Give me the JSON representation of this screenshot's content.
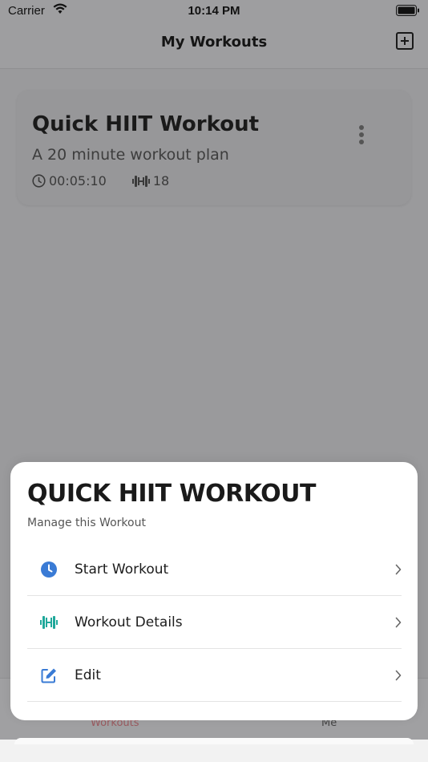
{
  "status_bar": {
    "carrier": "Carrier",
    "time": "10:14 PM"
  },
  "nav": {
    "title": "My Workouts",
    "add_icon": "plus-square-icon"
  },
  "workout_card": {
    "title": "Quick HIIT Workout",
    "subtitle": "A 20 minute workout plan",
    "duration": "00:05:10",
    "exercise_count": "18",
    "more_icon": "vertical-ellipsis-icon"
  },
  "tabs": [
    {
      "label": "Workouts",
      "active": true
    },
    {
      "label": "Me",
      "active": false
    }
  ],
  "sheet": {
    "title": "QUICK HIIT WORKOUT",
    "subtitle": "Manage this Workout",
    "actions": [
      {
        "label": "Start Workout",
        "icon": "clock-icon",
        "color": "#3a7bd5"
      },
      {
        "label": "Workout Details",
        "icon": "dumbbell-icon",
        "color": "#1fa89a"
      },
      {
        "label": "Edit",
        "icon": "edit-icon",
        "color": "#3a7bd5"
      }
    ]
  },
  "colors": {
    "accent_active_tab": "#c2545f",
    "overlay": "#9a9a9c"
  }
}
